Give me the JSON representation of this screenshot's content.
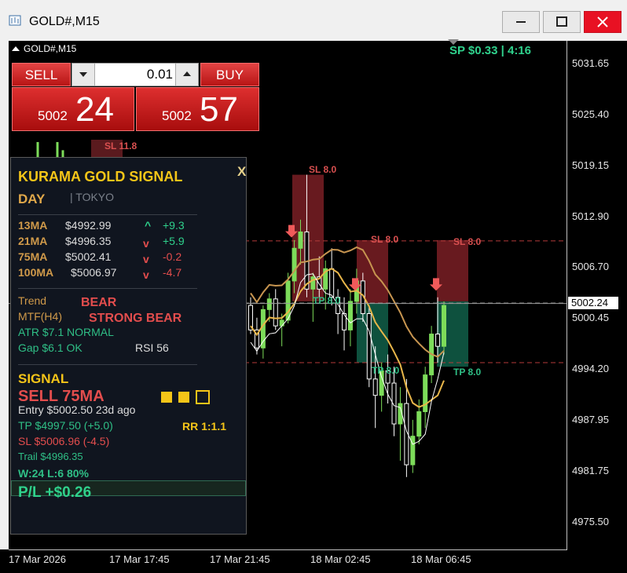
{
  "window": {
    "title": "GOLD#,M15"
  },
  "chart_header": {
    "symbol": "GOLD#,M15",
    "spread_text": "SP $0.33  |  4:16"
  },
  "trade_panel": {
    "sell_label": "SELL",
    "buy_label": "BUY",
    "lot": "0.01",
    "sell_price_small": "5002",
    "sell_price_big": "24",
    "buy_price_small": "5002",
    "buy_price_big": "57"
  },
  "signal_panel": {
    "title": "KURAMA GOLD SIGNAL",
    "close": "X",
    "session_type": "DAY",
    "session_name": "|  TOKYO",
    "ma_rows": [
      {
        "name": "13MA",
        "value": "$4992.99",
        "arrow": "^",
        "change": "+9.3"
      },
      {
        "name": "21MA",
        "value": "$4996.35",
        "arrow": "v",
        "change": "+5.9"
      },
      {
        "name": "75MA",
        "value": "$5002.41",
        "arrow": "v",
        "change": "-0.2"
      },
      {
        "name": "100MA",
        "value": "$5006.97",
        "arrow": "v",
        "change": "-4.7"
      }
    ],
    "trend_label": "Trend",
    "trend_value": "BEAR",
    "mtf_label": "MTF(H4)",
    "mtf_value": "STRONG BEAR",
    "atr": "ATR  $7.1  NORMAL",
    "gap": "Gap $6.1 OK",
    "rsi": "RSI 56",
    "signal_label": "SIGNAL",
    "signal_value": "SELL  75MA",
    "entry": "Entry  $5002.50   23d ago",
    "tp": "TP  $4997.50  (+5.0)",
    "sl": "SL  $5006.96  (-4.5)",
    "rr": "RR 1:1.1",
    "trail": "Trail  $4996.35",
    "winloss": "W:24 L:6  80%",
    "pl": "P/L  +$0.26"
  },
  "zone_labels": {
    "sl_top_left": "SL 11.8",
    "sl_1": "SL 8.0",
    "sl_2": "SL 8.0",
    "sl_3": "SL 8.0",
    "tp_1": "TP 8.0",
    "tp_2": "TP 8.0",
    "tp_3": "TP 8.0"
  },
  "colors": {
    "bull_candle": "#7ddc5a",
    "bear_candle": "#ffffff",
    "ma_fast": "#e8b64a",
    "ma_slow": "#c79550",
    "sl_zone": "#7a1f24",
    "tp_zone": "#0f5a45",
    "title_yellow": "#f5c518",
    "bear_red": "#e34d4d",
    "bull_green": "#2fd18c"
  },
  "chart_data": {
    "type": "candlestick",
    "symbol": "GOLD#",
    "timeframe": "M15",
    "y_ticks": [
      5031.65,
      5025.4,
      5019.15,
      5012.9,
      5006.7,
      5000.45,
      4994.2,
      4987.95,
      4981.75,
      4975.5
    ],
    "x_ticks": [
      "17 Mar 2026",
      "17 Mar 17:45",
      "17 Mar 21:45",
      "18 Mar 02:45",
      "18 Mar 06:45"
    ],
    "ylim": [
      4972.0,
      5034.5
    ],
    "current_price": "5002.24",
    "candles": [
      [
        5002.0,
        5003.0,
        4998.5,
        4999.0
      ],
      [
        4999.0,
        5000.5,
        4996.0,
        4996.8
      ],
      [
        4996.8,
        5002.0,
        4995.5,
        5001.5
      ],
      [
        5001.5,
        5003.5,
        5000.0,
        5002.8
      ],
      [
        5002.8,
        5004.0,
        4999.0,
        4999.5
      ],
      [
        4999.5,
        5001.0,
        4997.0,
        5000.2
      ],
      [
        5000.2,
        5006.0,
        4999.8,
        5005.0
      ],
      [
        5005.0,
        5010.0,
        5003.5,
        5009.0
      ],
      [
        5009.0,
        5012.5,
        5007.0,
        5011.0
      ],
      [
        5011.0,
        5018.0,
        5003.0,
        5004.0
      ],
      [
        5004.0,
        5006.0,
        5000.0,
        5005.5
      ],
      [
        5005.5,
        5008.0,
        5003.0,
        5004.0
      ],
      [
        5004.0,
        5007.5,
        5001.5,
        5006.5
      ],
      [
        5006.5,
        5009.0,
        5002.0,
        5003.0
      ],
      [
        5003.0,
        5004.0,
        4998.5,
        5001.0
      ],
      [
        5001.0,
        5003.0,
        4996.5,
        4999.0
      ],
      [
        4999.0,
        5004.0,
        4997.0,
        5002.5
      ],
      [
        5002.5,
        5006.5,
        5001.0,
        5005.0
      ],
      [
        5005.0,
        5006.0,
        5000.0,
        5001.0
      ],
      [
        5001.0,
        5002.0,
        4992.0,
        4993.0
      ],
      [
        4993.0,
        4997.0,
        4987.0,
        4991.0
      ],
      [
        4991.0,
        4995.0,
        4989.0,
        4994.0
      ],
      [
        4994.0,
        4996.0,
        4990.0,
        4992.5
      ],
      [
        4992.5,
        4994.5,
        4986.0,
        4987.5
      ],
      [
        4987.5,
        4992.0,
        4983.0,
        4990.0
      ],
      [
        4990.0,
        4993.0,
        4981.0,
        4982.5
      ],
      [
        4982.5,
        4988.0,
        4981.5,
        4986.0
      ],
      [
        4986.0,
        4990.5,
        4985.0,
        4989.0
      ],
      [
        4989.0,
        4994.5,
        4987.0,
        4993.5
      ],
      [
        4993.5,
        4999.5,
        4992.5,
        4998.5
      ],
      [
        4998.5,
        5003.0,
        4995.0,
        4997.0
      ],
      [
        4997.0,
        5002.5,
        4996.0,
        5002.0
      ]
    ]
  }
}
